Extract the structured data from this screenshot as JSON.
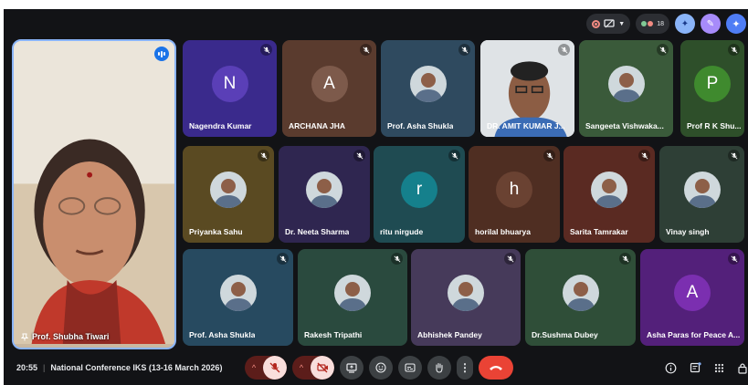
{
  "topbar": {
    "participant_count": "18"
  },
  "self_tile": {
    "name": "Prof. Shubha Tiwari"
  },
  "tiles": [
    {
      "name": "Nagendra Kumar",
      "letter": "N",
      "bg": "#3a2a8c",
      "avatar": "#5a3fb7",
      "muted": true
    },
    {
      "name": "ARCHANA JHA",
      "letter": "A",
      "bg": "#5a3b2e",
      "avatar": "#7d5a4b",
      "muted": true
    },
    {
      "name": "Prof. Asha Shukla",
      "bg": "#2f4a5f",
      "photo": true,
      "muted": true
    },
    {
      "name": "DR. AMIT KUMAR J...",
      "bg": "#d9dfe4",
      "camera": true,
      "muted": true
    },
    {
      "name": "Sangeeta Vishwaka...",
      "bg": "#3a5a3a",
      "photo": true,
      "muted": true
    },
    {
      "name": "Prof R K Shu...",
      "letter": "P",
      "bg": "#2e4f2a",
      "avatar": "#3f8a2e",
      "muted": true
    },
    {
      "name": "Priyanka Sahu",
      "bg": "#5a4a22",
      "photo": true,
      "muted": true
    },
    {
      "name": "Dr. Neeta Sharma",
      "bg": "#2f2650",
      "photo": true,
      "muted": true
    },
    {
      "name": "ritu nirgude",
      "letter": "r",
      "bg": "#1f4b52",
      "avatar": "#15808c",
      "muted": true
    },
    {
      "name": "horilal bhuarya",
      "letter": "h",
      "bg": "#4f2e22",
      "avatar": "#6a4232",
      "muted": true
    },
    {
      "name": "Sarita Tamrakar",
      "bg": "#5a2a22",
      "photo": true,
      "muted": true
    },
    {
      "name": "Vinay singh",
      "bg": "#2e3f36",
      "photo": true,
      "muted": true
    },
    {
      "name": "Prof. Asha Shukla",
      "bg": "#274a60",
      "photo": true,
      "muted": true
    },
    {
      "name": "Rakesh Tripathi",
      "bg": "#2a4a3e",
      "photo": true,
      "muted": true
    },
    {
      "name": "Abhishek Pandey",
      "bg": "#463a5a",
      "photo": true,
      "muted": false
    },
    {
      "name": "Dr.Sushma Dubey",
      "bg": "#2f4e38",
      "photo": true,
      "muted": true
    },
    {
      "name": "Asha Paras for Peace A...",
      "letter": "A",
      "bg": "#53207a",
      "avatar": "#7b2fb0",
      "muted": true
    }
  ],
  "bottombar": {
    "time": "20:55",
    "meeting_title": "National Conference IKS (13-16 March 2026)"
  }
}
